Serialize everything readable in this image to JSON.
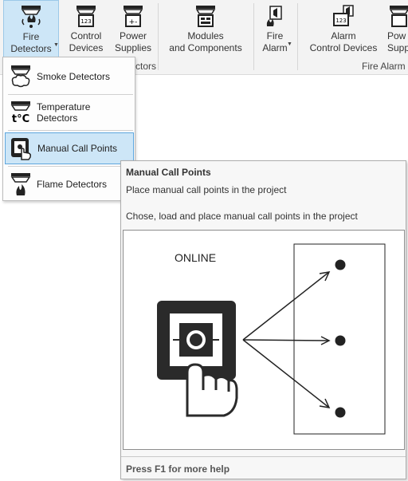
{
  "ribbon": {
    "buttons": [
      {
        "label": "Fire\nDetectors",
        "icon": "fire-detector-icon"
      },
      {
        "label": "Control\nDevices",
        "icon": "control-device-icon"
      },
      {
        "label": "Power\nSupplies",
        "icon": "power-supply-icon"
      },
      {
        "label": "Modules\nand Components",
        "icon": "module-icon"
      },
      {
        "label": "Fire\nAlarm",
        "icon": "fire-alarm-icon"
      },
      {
        "label": "Alarm\nControl Devices",
        "icon": "alarm-control-icon"
      },
      {
        "label": "Pow\nSupp",
        "icon": "power-supply-icon"
      }
    ],
    "groups": [
      "ctors",
      "Fire Alarm"
    ]
  },
  "menu": {
    "items": [
      {
        "label": "Smoke Detectors",
        "icon": "smoke-detector-icon"
      },
      {
        "label": "Temperature Detectors",
        "icon": "temperature-detector-icon"
      },
      {
        "label": "Manual Call Points",
        "icon": "manual-call-point-icon"
      },
      {
        "label": "Flame Detectors",
        "icon": "flame-detector-icon"
      }
    ]
  },
  "tooltip": {
    "title": "Manual Call Points",
    "line1": "Place manual call points in the project",
    "line2": "Chose, load and place manual call points in the project",
    "image_label": "ONLINE",
    "footer": "Press F1 for more help"
  }
}
